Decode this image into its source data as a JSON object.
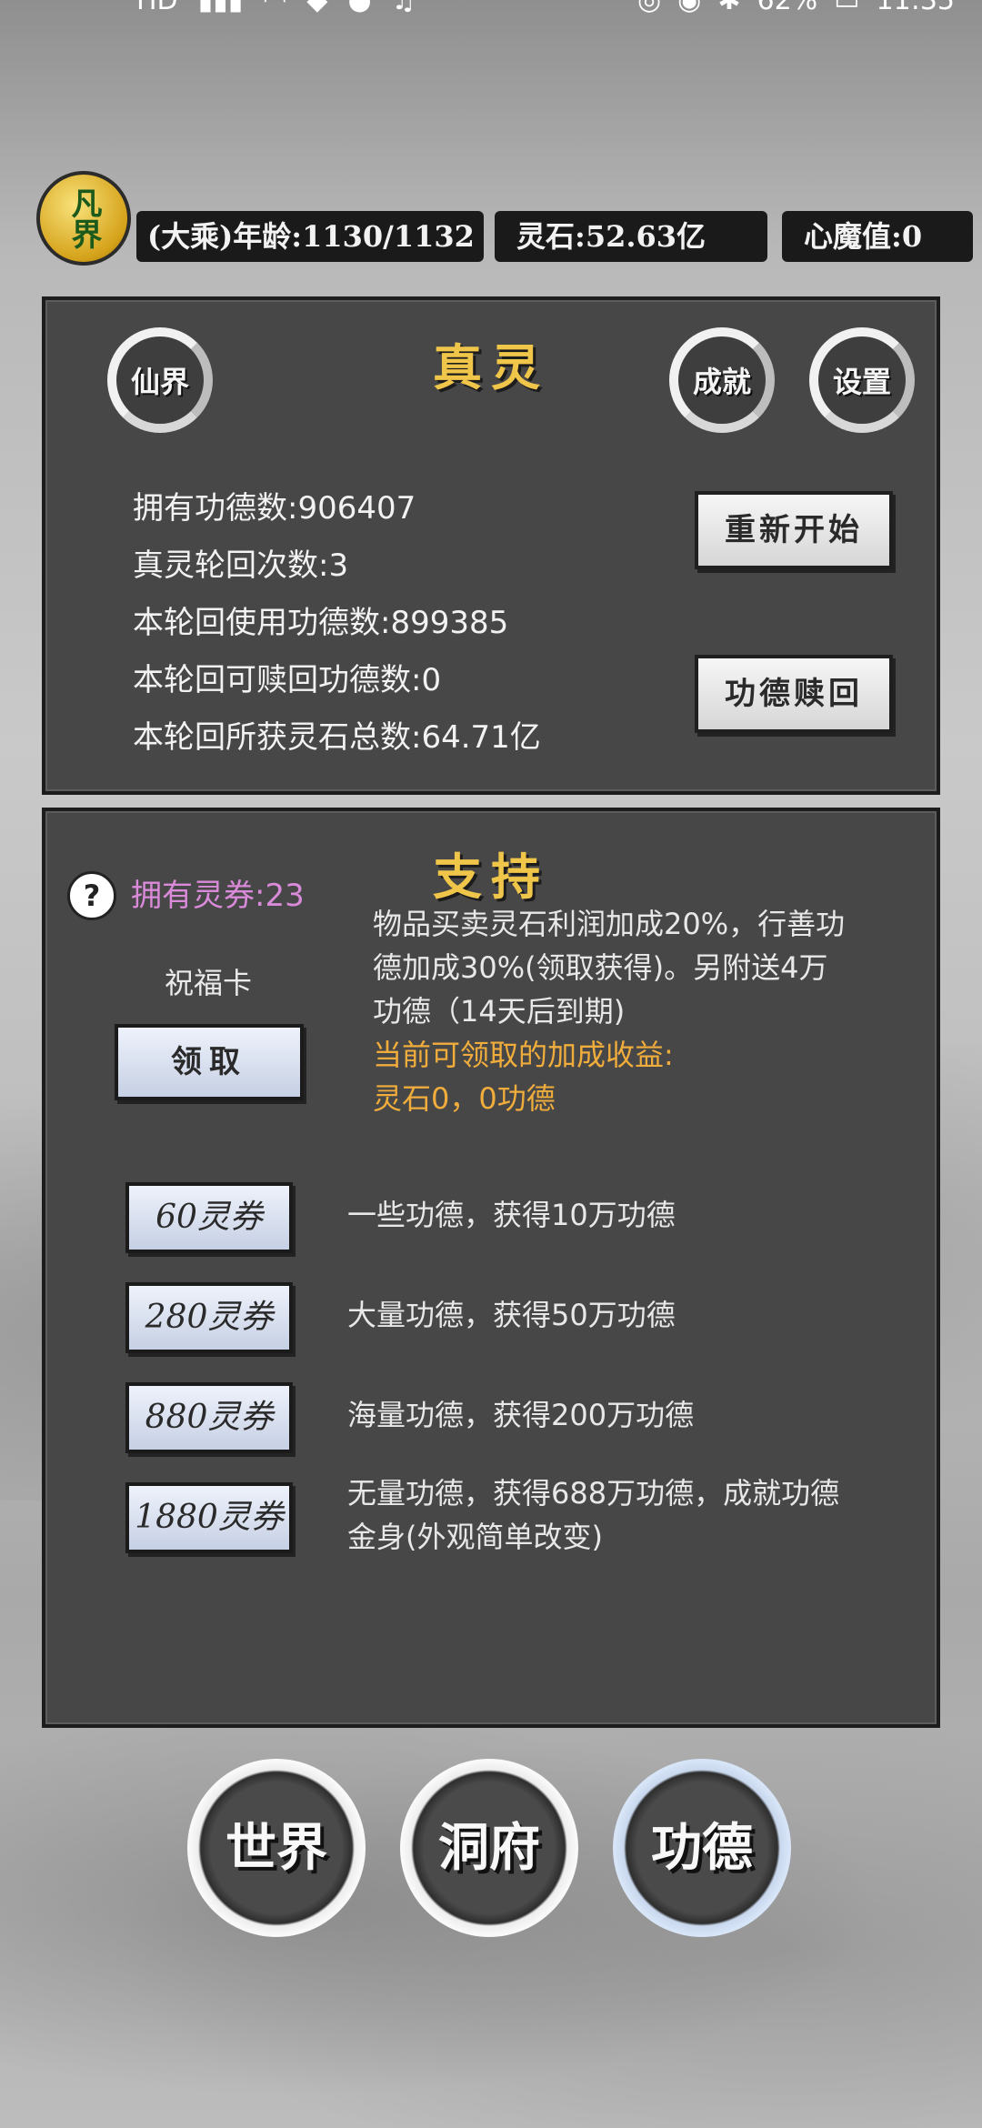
{
  "status_bar": {
    "left_icons": [
      "HD",
      "signal-icon",
      "wifi-icon",
      "shield-icon",
      "app-icon",
      "music-icon"
    ],
    "battery": "62%",
    "time": "11:35"
  },
  "header": {
    "avatar_text": "凡界",
    "age_label": "(大乘)年龄:1130/1132",
    "spirit_stone_label": "灵石:52.63亿",
    "demon_value_label": "心魔值:0"
  },
  "true_spirit": {
    "title": "真灵",
    "immortal_realm_button": "仙界",
    "achievements_button": "成就",
    "settings_button": "设置",
    "stats": [
      "拥有功德数:906407",
      "真灵轮回次数:3",
      "本轮回使用功德数:899385",
      "本轮回可赎回功德数:0",
      "本轮回所获灵石总数:64.71亿"
    ],
    "restart_button": "重新开始",
    "redeem_button": "功德赎回"
  },
  "support": {
    "title": "支持",
    "help_icon": "?",
    "coupons_label": "拥有灵券:23",
    "blessing_card": {
      "label": "祝福卡",
      "claim_button": "领取",
      "desc_line1": "物品买卖灵石利润加成20%，行善功",
      "desc_line2": "德加成30%(领取获得)。另附送4万",
      "desc_line3": "功德（14天后到期)",
      "current_line1": "当前可领取的加成收益:",
      "current_line2": "灵石0，0功德"
    },
    "packs": [
      {
        "button": "60灵券",
        "desc_line1": "一些功德，获得10万功德",
        "desc_line2": ""
      },
      {
        "button": "280灵券",
        "desc_line1": "大量功德，获得50万功德",
        "desc_line2": ""
      },
      {
        "button": "880灵券",
        "desc_line1": "海量功德，获得200万功德",
        "desc_line2": ""
      },
      {
        "button": "1880灵券",
        "desc_line1": "无量功德，获得688万功德，成就功德",
        "desc_line2": "金身(外观简单改变)"
      }
    ]
  },
  "nav": {
    "world": "世界",
    "cave": "洞府",
    "merit": "功德",
    "active": "功德"
  }
}
